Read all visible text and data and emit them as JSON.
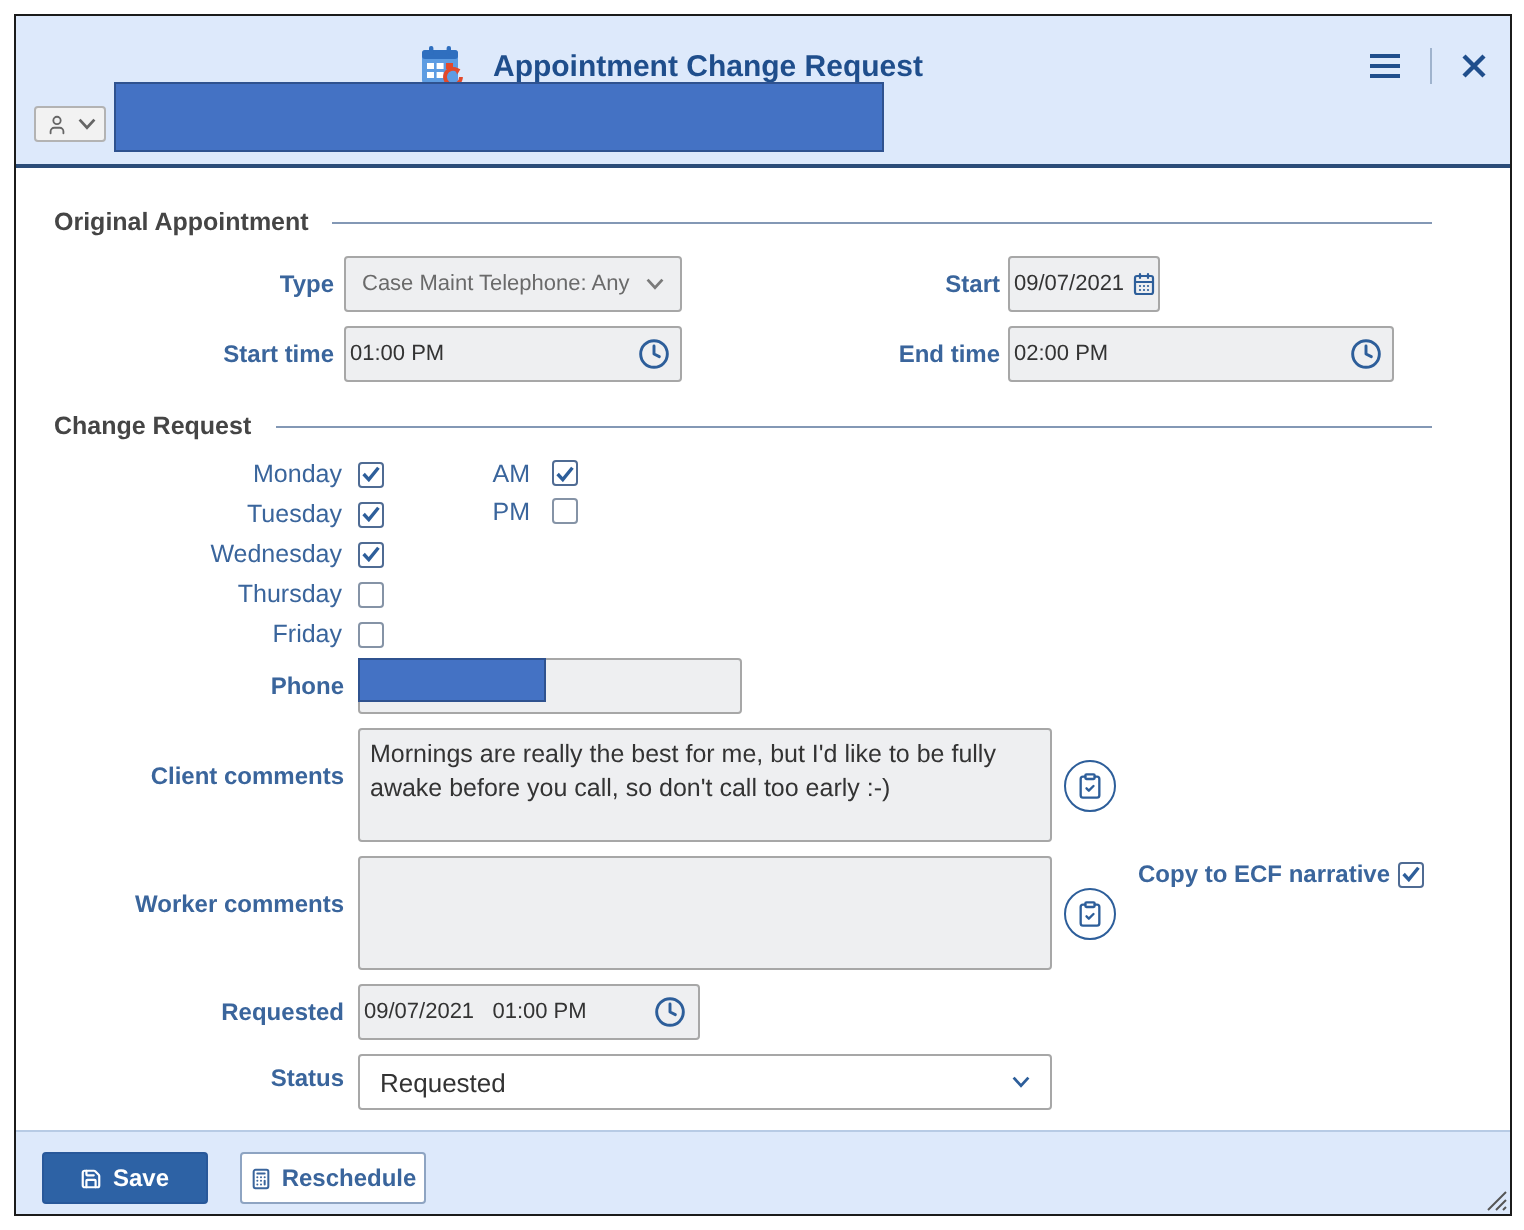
{
  "window": {
    "title": "Appointment Change Request"
  },
  "original_appointment": {
    "heading": "Original Appointment",
    "type": {
      "label": "Type",
      "value": "Case Maint Telephone: Any",
      "disabled": true
    },
    "start": {
      "label": "Start",
      "value": "09/07/2021",
      "disabled": true
    },
    "start_time": {
      "label": "Start time",
      "value": "01:00 PM",
      "disabled": true
    },
    "end_time": {
      "label": "End time",
      "value": "02:00 PM",
      "disabled": true
    }
  },
  "change_request": {
    "heading": "Change Request",
    "days": [
      {
        "label": "Monday",
        "checked": true
      },
      {
        "label": "Tuesday",
        "checked": true
      },
      {
        "label": "Wednesday",
        "checked": true
      },
      {
        "label": "Thursday",
        "checked": false
      },
      {
        "label": "Friday",
        "checked": false
      }
    ],
    "periods": [
      {
        "label": "AM",
        "checked": true
      },
      {
        "label": "PM",
        "checked": false
      }
    ],
    "phone": {
      "label": "Phone",
      "disabled": true
    },
    "client_comments": {
      "label": "Client comments",
      "value": "Mornings are really the best for me, but I'd like to be fully awake before you call, so don't call too early :-)",
      "disabled": true
    },
    "worker_comments": {
      "label": "Worker comments",
      "disabled": true
    },
    "copy_to_ecf_narrative": {
      "label": "Copy to ECF narrative",
      "checked": true
    },
    "requested": {
      "label": "Requested",
      "value": "09/07/2021   01:00 PM",
      "disabled": true
    },
    "status": {
      "label": "Status",
      "value": "Requested",
      "disabled": false
    }
  },
  "buttons": [
    {
      "label": "Save",
      "kind": "primary"
    },
    {
      "label": "Reschedule",
      "kind": "secondary"
    }
  ]
}
